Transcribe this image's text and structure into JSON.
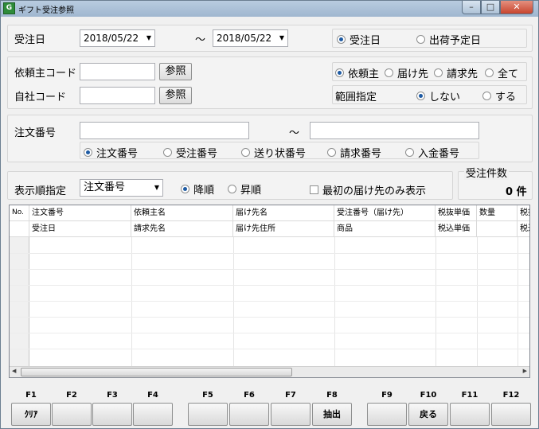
{
  "window": {
    "title": "ギフト受注参照",
    "icon_letter": "G",
    "min": "–",
    "max": "□",
    "close": "✕"
  },
  "date_section": {
    "label": "受注日",
    "from": "2018/05/22",
    "to": "2018/05/22",
    "tilde": "～",
    "radios": [
      {
        "label": "受注日",
        "checked": true
      },
      {
        "label": "出荷予定日",
        "checked": false
      }
    ]
  },
  "client_section": {
    "client_code_label": "依頼主コード",
    "own_code_label": "自社コード",
    "ref_button": "参照",
    "target_radios": [
      {
        "label": "依頼主",
        "checked": true
      },
      {
        "label": "届け先",
        "checked": false
      },
      {
        "label": "請求先",
        "checked": false
      },
      {
        "label": "全て",
        "checked": false
      }
    ],
    "range_label": "範囲指定",
    "range_radios": [
      {
        "label": "しない",
        "checked": true
      },
      {
        "label": "する",
        "checked": false
      }
    ]
  },
  "order_section": {
    "label": "注文番号",
    "tilde": "～",
    "radios": [
      {
        "label": "注文番号",
        "checked": true
      },
      {
        "label": "受注番号",
        "checked": false
      },
      {
        "label": "送り状番号",
        "checked": false
      },
      {
        "label": "請求番号",
        "checked": false
      },
      {
        "label": "入金番号",
        "checked": false
      }
    ]
  },
  "sort_section": {
    "label": "表示順指定",
    "sort_value": "注文番号",
    "radios": [
      {
        "label": "降順",
        "checked": true
      },
      {
        "label": "昇順",
        "checked": false
      }
    ],
    "first_only_label": "最初の届け先のみ表示",
    "count_label": "受注件数",
    "count_value": "0 件"
  },
  "grid": {
    "no_header": "No.",
    "row1": [
      "注文番号",
      "依頼主名",
      "届け先名",
      "受注番号（届け先）",
      "税抜単価",
      "数量",
      "税抜"
    ],
    "row2": [
      "受注日",
      "請求先名",
      "届け先住所",
      "商品",
      "税込単価",
      "",
      "税込"
    ]
  },
  "fkeys": [
    {
      "key": "F1",
      "label": "ｸﾘｱ"
    },
    {
      "key": "F2",
      "label": ""
    },
    {
      "key": "F3",
      "label": ""
    },
    {
      "key": "F4",
      "label": ""
    },
    {
      "key": "F5",
      "label": ""
    },
    {
      "key": "F6",
      "label": ""
    },
    {
      "key": "F7",
      "label": ""
    },
    {
      "key": "F8",
      "label": "抽出"
    },
    {
      "key": "F9",
      "label": ""
    },
    {
      "key": "F10",
      "label": "戻る"
    },
    {
      "key": "F11",
      "label": ""
    },
    {
      "key": "F12",
      "label": ""
    }
  ]
}
